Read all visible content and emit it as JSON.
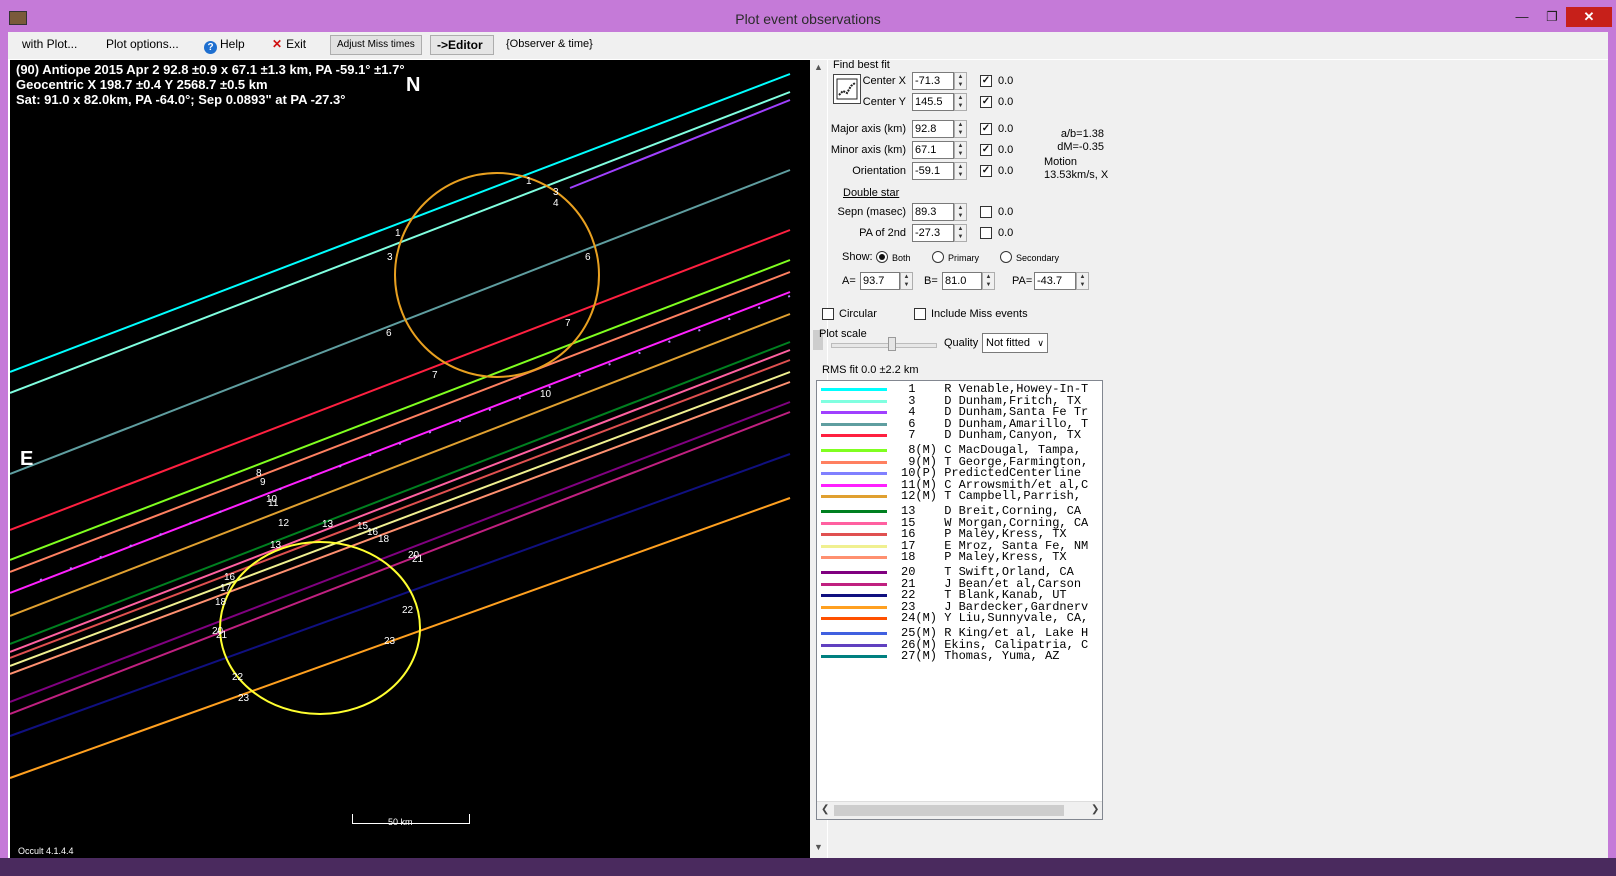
{
  "window": {
    "title": "Plot event observations",
    "minimize_icon": "minimize-icon",
    "maximize_icon": "restore-icon",
    "close_icon": "close-icon"
  },
  "menu": {
    "with_plot": "with Plot...",
    "plot_options": "Plot options...",
    "help": "Help",
    "exit": "Exit",
    "adjust_miss": "Adjust Miss times",
    "editor": "->Editor",
    "observer_time": "{Observer & time}"
  },
  "plot": {
    "line1": "(90) Antiope  2015 Apr 2   92.8 ±0.9 x 67.1 ±1.3 km,  PA -59.1° ±1.7°",
    "line2": "Geocentric  X  198.7 ±0.4  Y 2568.7 ±0.5 km",
    "line3": "Sat: 91.0 x 82.0km, PA -64.0°; Sep 0.0893\" at PA -27.3°",
    "north": "N",
    "east": "E",
    "version": "Occult 4.1.4.4",
    "scale_label": "50 km"
  },
  "panel": {
    "find_best_fit": "Find best fit",
    "center_x_label": "Center X",
    "center_x": "-71.3",
    "center_y_label": "Center Y",
    "center_y": "145.5",
    "major_label": "Major axis (km)",
    "major": "92.8",
    "minor_label": "Minor axis (km)",
    "minor": "67.1",
    "orient_label": "Orientation",
    "orient": "-59.1",
    "zero": "0.0",
    "ab": "a/b=1.38",
    "dm": "dM=-0.35",
    "motion": "Motion",
    "motion_val": "13.53km/s, X",
    "double_star": "Double star",
    "sepn_label": "Sepn (masec)",
    "sepn": "89.3",
    "pa2_label": "PA of 2nd",
    "pa2": "-27.3",
    "show_label": "Show:",
    "show_both": "Both",
    "show_primary": "Primary",
    "show_secondary": "Secondary",
    "a_label": "A=",
    "a_val": "93.7",
    "b_label": "B=",
    "b_val": "81.0",
    "pa_label": "PA=",
    "pa_val": "-43.7",
    "circular": "Circular",
    "include_miss": "Include Miss events",
    "plot_scale": "Plot scale",
    "quality_label": "Quality",
    "quality": "Not fitted",
    "rms": "RMS fit 0.0 ±2.2 km"
  },
  "legend": [
    {
      "num": "1",
      "flag": "",
      "obs": "R Venable,Howey-In-T",
      "color": "#00ffff",
      "gap": false
    },
    {
      "num": "3",
      "flag": "",
      "obs": "D Dunham,Fritch, TX",
      "color": "#80ffe0",
      "gap": false
    },
    {
      "num": "4",
      "flag": "",
      "obs": "D Dunham,Santa Fe Tr",
      "color": "#a040ff",
      "gap": false
    },
    {
      "num": "6",
      "flag": "",
      "obs": "D Dunham,Amarillo, T",
      "color": "#5f9ea0",
      "gap": false
    },
    {
      "num": "7",
      "flag": "",
      "obs": "D Dunham,Canyon, TX",
      "color": "#ff2040",
      "gap": false
    },
    {
      "num": "8",
      "flag": "(M)",
      "obs": "C MacDougal, Tampa,",
      "color": "#80ff20",
      "gap": true
    },
    {
      "num": "9",
      "flag": "(M)",
      "obs": "T George,Farmington,",
      "color": "#ff8060",
      "gap": false
    },
    {
      "num": "10",
      "flag": "(P)",
      "obs": "PredictedCenterline",
      "color": "#8080ff",
      "gap": false
    },
    {
      "num": "11",
      "flag": "(M)",
      "obs": "C Arrowsmith/et al,C",
      "color": "#ff20ff",
      "gap": false
    },
    {
      "num": "12",
      "flag": "(M)",
      "obs": "T Campbell,Parrish,",
      "color": "#e0a030",
      "gap": false
    },
    {
      "num": "13",
      "flag": "",
      "obs": "D Breit,Corning, CA",
      "color": "#008020",
      "gap": true
    },
    {
      "num": "15",
      "flag": "",
      "obs": "W Morgan,Corning, CA",
      "color": "#ff60a0",
      "gap": false
    },
    {
      "num": "16",
      "flag": "",
      "obs": "P Maley,Kress, TX",
      "color": "#e05050",
      "gap": false
    },
    {
      "num": "17",
      "flag": "",
      "obs": "E Mroz, Santa Fe, NM",
      "color": "#f0f090",
      "gap": false
    },
    {
      "num": "18",
      "flag": "",
      "obs": "P Maley,Kress, TX",
      "color": "#ff9070",
      "gap": false
    },
    {
      "num": "20",
      "flag": "",
      "obs": "T Swift,Orland, CA",
      "color": "#800080",
      "gap": true
    },
    {
      "num": "21",
      "flag": "",
      "obs": "J Bean/et al,Carson",
      "color": "#c02080",
      "gap": false
    },
    {
      "num": "22",
      "flag": "",
      "obs": "T Blank,Kanab, UT",
      "color": "#101080",
      "gap": false
    },
    {
      "num": "23",
      "flag": "",
      "obs": "J Bardecker,Gardnerv",
      "color": "#ffa020",
      "gap": false
    },
    {
      "num": "24",
      "flag": "(M)",
      "obs": "Y Liu,Sunnyvale, CA,",
      "color": "#ff5000",
      "gap": false
    },
    {
      "num": "25",
      "flag": "(M)",
      "obs": "R King/et al, Lake H",
      "color": "#4060e0",
      "gap": true
    },
    {
      "num": "26",
      "flag": "(M)",
      "obs": "Ekins, Calipatria, C",
      "color": "#6040c0",
      "gap": false
    },
    {
      "num": "27",
      "flag": "(M)",
      "obs": "Thomas, Yuma, AZ",
      "color": "#008080",
      "gap": false
    }
  ]
}
